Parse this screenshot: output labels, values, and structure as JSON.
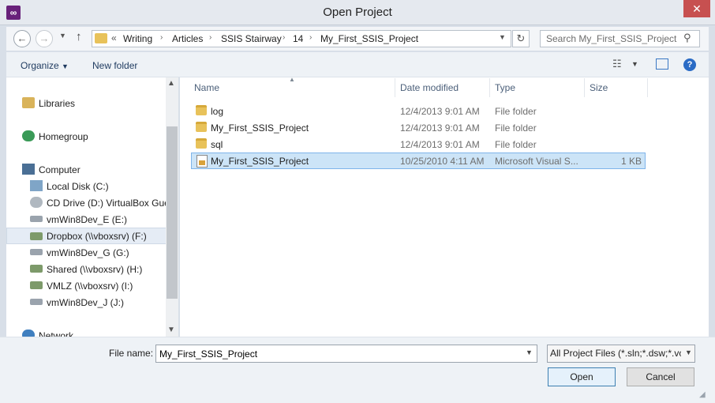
{
  "window": {
    "title": "Open Project",
    "app_icon": "visual-studio-icon",
    "close_label": "✕"
  },
  "address": {
    "overflow": "«",
    "crumbs": [
      "Writing",
      "Articles",
      "SSIS Stairway",
      "14",
      "My_First_SSIS_Project"
    ],
    "search_placeholder": "Search My_First_SSIS_Project"
  },
  "toolbar": {
    "organize_label": "Organize",
    "new_folder_label": "New folder"
  },
  "nav": {
    "items": [
      {
        "label": "Libraries",
        "icon": "libraries-icon"
      },
      {
        "label": "Homegroup",
        "icon": "homegroup-icon"
      },
      {
        "label": "Computer",
        "icon": "computer-icon"
      },
      {
        "label": "Local Disk (C:)",
        "icon": "local-disk-icon"
      },
      {
        "label": "CD Drive (D:) VirtualBox Gues",
        "icon": "cd-drive-icon"
      },
      {
        "label": "vmWin8Dev_E (E:)",
        "icon": "drive-icon"
      },
      {
        "label": "Dropbox (\\\\vboxsrv) (F:)",
        "icon": "network-drive-icon"
      },
      {
        "label": "vmWin8Dev_G (G:)",
        "icon": "drive-icon"
      },
      {
        "label": "Shared (\\\\vboxsrv) (H:)",
        "icon": "network-drive-icon"
      },
      {
        "label": "VMLZ (\\\\vboxsrv) (I:)",
        "icon": "network-drive-icon"
      },
      {
        "label": "vmWin8Dev_J (J:)",
        "icon": "drive-icon"
      },
      {
        "label": "Network",
        "icon": "network-icon"
      }
    ]
  },
  "files": {
    "columns": [
      "Name",
      "Date modified",
      "Type",
      "Size"
    ],
    "rows": [
      {
        "name": "log",
        "date": "12/4/2013 9:01 AM",
        "type": "File folder",
        "size": ""
      },
      {
        "name": "My_First_SSIS_Project",
        "date": "12/4/2013 9:01 AM",
        "type": "File folder",
        "size": ""
      },
      {
        "name": "sql",
        "date": "12/4/2013 9:01 AM",
        "type": "File folder",
        "size": ""
      },
      {
        "name": "My_First_SSIS_Project",
        "date": "10/25/2010 4:11 AM",
        "type": "Microsoft Visual S...",
        "size": "1 KB"
      }
    ]
  },
  "bottom": {
    "filename_label": "File name:",
    "filename_value": "My_First_SSIS_Project",
    "filetype_value": "All Project Files (*.sln;*.dsw;*.vc",
    "open_label": "Open",
    "cancel_label": "Cancel"
  },
  "colors": {
    "accent": "#3c7fb1",
    "selection": "#cce4f7",
    "close": "#c75050",
    "folder": "#e8c25a"
  }
}
